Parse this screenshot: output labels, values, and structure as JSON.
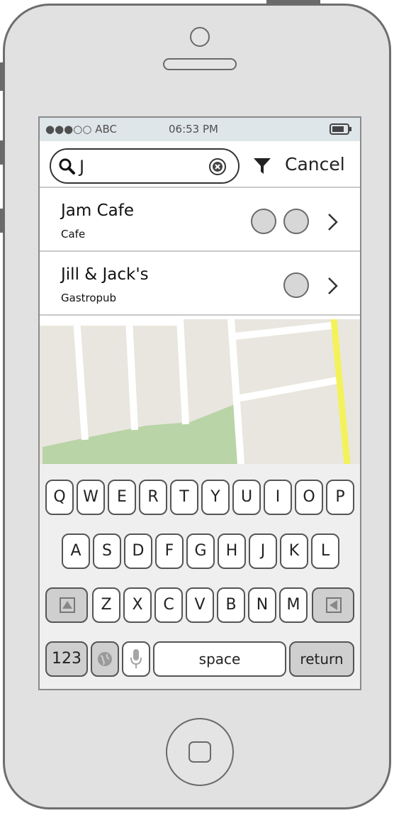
{
  "status_bar": {
    "carrier": "●●●○○ ABC",
    "time": "06:53 PM"
  },
  "search": {
    "value": "J"
  },
  "cancel_label": "Cancel",
  "results": [
    {
      "title": "Jam Cafe",
      "subtitle": "Cafe"
    },
    {
      "title": "Jill & Jack's",
      "subtitle": "Gastropub"
    }
  ],
  "keyboard": {
    "row1": [
      "Q",
      "W",
      "E",
      "R",
      "T",
      "Y",
      "U",
      "I",
      "O",
      "P"
    ],
    "row2": [
      "A",
      "S",
      "D",
      "F",
      "G",
      "H",
      "J",
      "K",
      "L"
    ],
    "row3": [
      "Z",
      "X",
      "C",
      "V",
      "B",
      "N",
      "M"
    ],
    "numbers_label": "123",
    "space_label": "space",
    "return_label": "return"
  },
  "colors": {
    "map_park": "#b9d4a6",
    "map_highway": "#f4f25a",
    "status_bar_bg": "#dfe6ea"
  },
  "icons": [
    "search-icon",
    "clear-icon",
    "filter-icon",
    "chevron-right-icon",
    "shift-icon",
    "backspace-icon",
    "globe-icon",
    "microphone-icon",
    "battery-icon"
  ]
}
